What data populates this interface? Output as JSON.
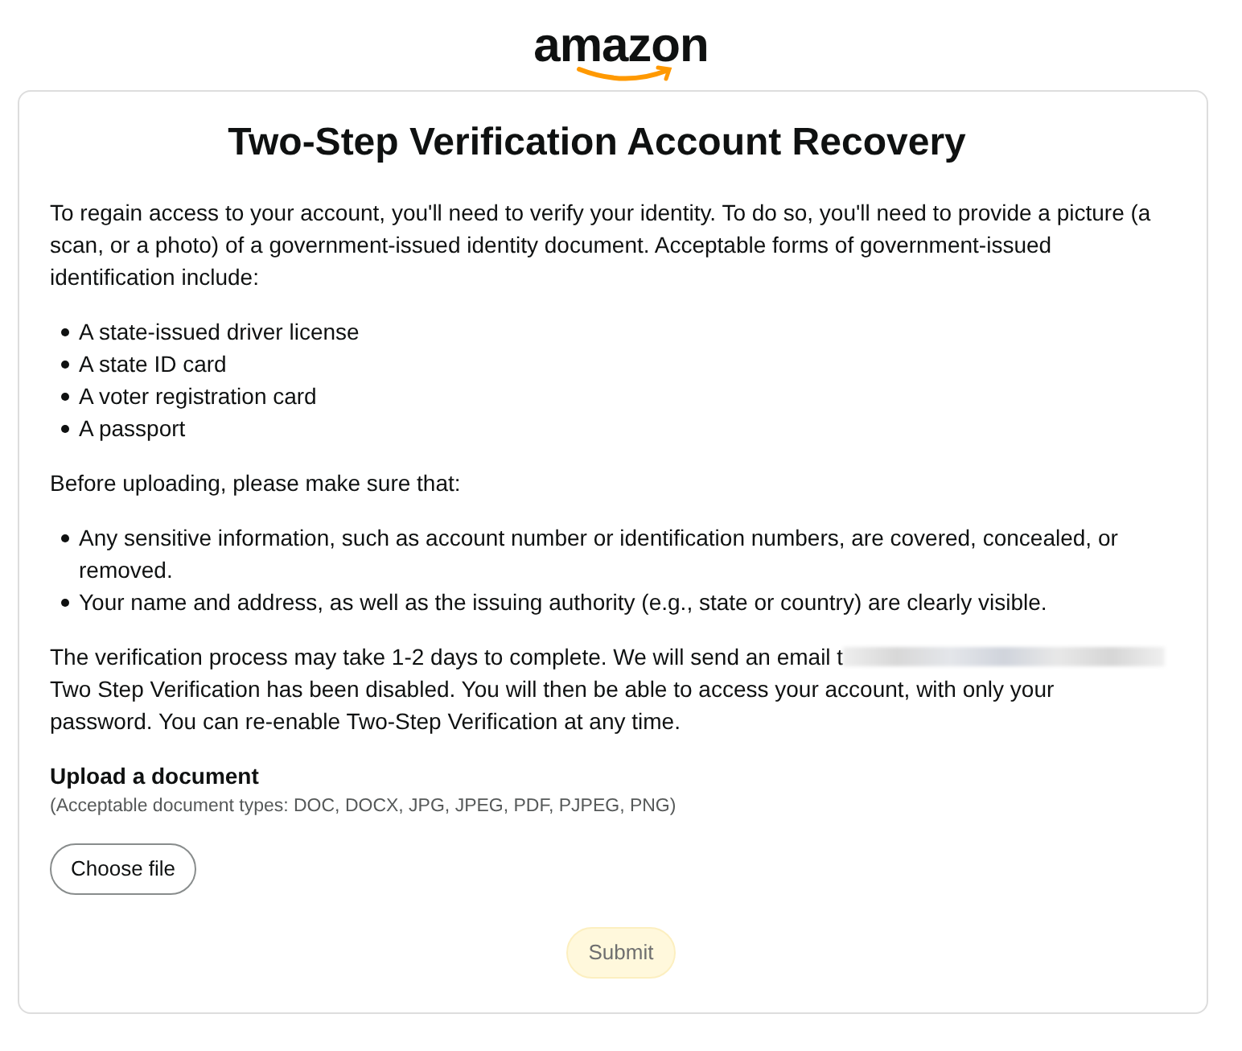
{
  "logo": {
    "text": "amazon"
  },
  "title": "Two-Step Verification Account Recovery",
  "intro": "To regain access to your account, you'll need to verify your identity. To do so, you'll need to provide a picture (a scan, or a photo) of a government-issued identity document. Acceptable forms of government-issued identification include:",
  "documents": [
    "A state-issued driver license",
    "A state ID card",
    "A voter registration card",
    "A passport"
  ],
  "checklist_intro": "Before uploading, please make sure that:",
  "checklist": [
    "Any sensitive information, such as account number or identification numbers, are covered, concealed, or removed.",
    "Your name and address, as well as the issuing authority (e.g., state or country) are clearly visible."
  ],
  "notice": {
    "before_redaction": "The verification process may take 1-2 days to complete. We will send an email t",
    "after_redaction": "Two Step Verification has been disabled. You will then be able to access your account, with only your password. You can re-enable Two-Step Verification at any time."
  },
  "upload": {
    "heading": "Upload a document",
    "hint": "(Acceptable document types: DOC, DOCX, JPG, JPEG, PDF, PJPEG, PNG)",
    "choose_button": "Choose file"
  },
  "submit": {
    "label": "Submit",
    "disabled": true
  }
}
